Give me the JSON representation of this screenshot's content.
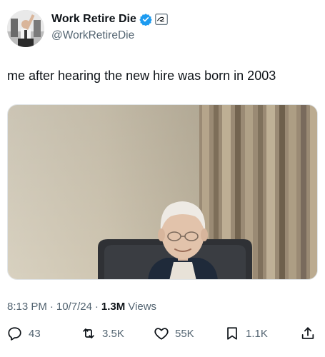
{
  "author": {
    "display_name": "Work Retire Die",
    "handle": "@WorkRetireDie"
  },
  "tweet": {
    "text": "me after hearing the new hire was born in 2003"
  },
  "meta": {
    "time": "8:13 PM",
    "separator": "·",
    "date": "10/7/24",
    "views_count": "1.3M",
    "views_label": "Views"
  },
  "actions": {
    "replies": "43",
    "reposts": "3.5K",
    "likes": "55K",
    "bookmarks": "1.1K"
  },
  "colors": {
    "text_primary": "#0f1419",
    "text_secondary": "#536471",
    "verified_blue": "#1d9bf0"
  },
  "icons": {
    "verified": "verified-badge-icon",
    "affiliate": "affiliate-badge-icon",
    "reply": "reply-icon",
    "repost": "repost-icon",
    "like": "heart-icon",
    "bookmark": "bookmark-icon",
    "share": "share-icon"
  }
}
